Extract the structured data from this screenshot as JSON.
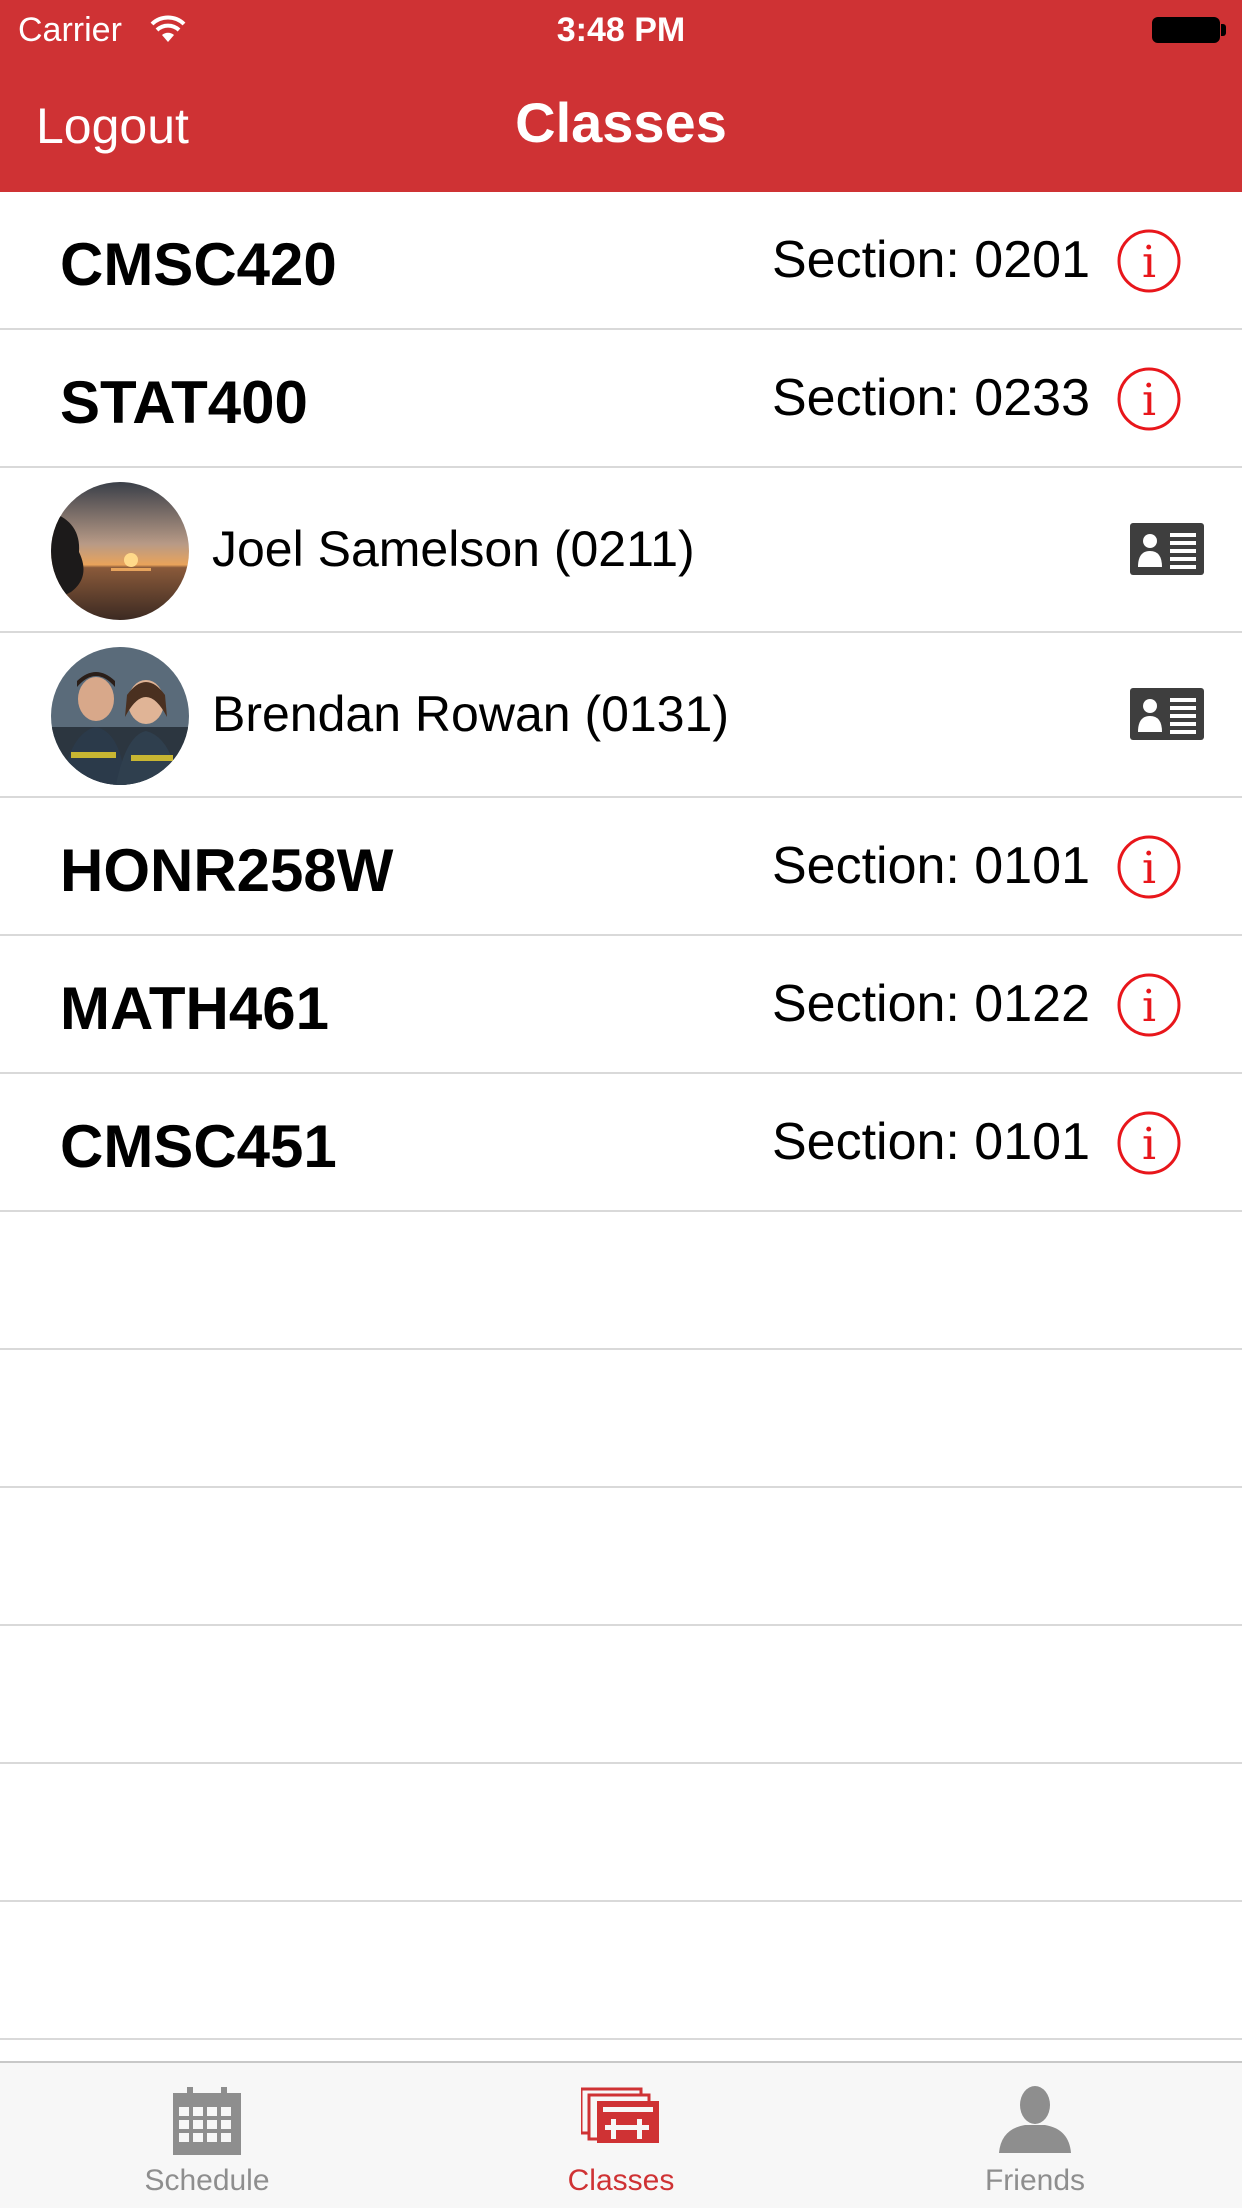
{
  "status_bar": {
    "carrier": "Carrier",
    "time": "3:48 PM"
  },
  "nav": {
    "left_button": "Logout",
    "title": "Classes"
  },
  "rows": [
    {
      "type": "course",
      "name": "CMSC420",
      "section": "Section: 0201",
      "icon": "info-icon"
    },
    {
      "type": "course",
      "name": "STAT400",
      "section": "Section: 0233",
      "icon": "info-icon"
    },
    {
      "type": "friend",
      "name": "Joel Samelson (0211)",
      "icon": "contact-card-icon"
    },
    {
      "type": "friend",
      "name": "Brendan Rowan (0131)",
      "icon": "contact-card-icon"
    },
    {
      "type": "course",
      "name": "HONR258W",
      "section": "Section: 0101",
      "icon": "info-icon"
    },
    {
      "type": "course",
      "name": "MATH461",
      "section": "Section: 0122",
      "icon": "info-icon"
    },
    {
      "type": "course",
      "name": "CMSC451",
      "section": "Section: 0101",
      "icon": "info-icon"
    }
  ],
  "tabs": [
    {
      "label": "Schedule",
      "icon": "calendar-icon",
      "active": false
    },
    {
      "label": "Classes",
      "icon": "classes-icon",
      "active": true
    },
    {
      "label": "Friends",
      "icon": "person-icon",
      "active": false
    }
  ],
  "colors": {
    "accent": "#cf3234",
    "info": "#e8161b",
    "separator": "#d9d9d9",
    "tab_inactive": "#8e8e8e"
  }
}
